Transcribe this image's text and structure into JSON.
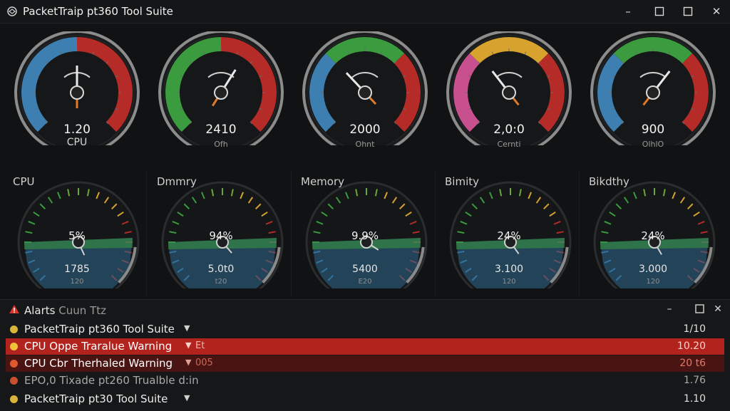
{
  "window": {
    "title": "PacketTraip pt360 Tool Suite",
    "controls": [
      "–",
      "☐",
      "✕"
    ]
  },
  "top_gauges": [
    {
      "value": "1.20",
      "label": "CPU",
      "needle_fraction": 0.5,
      "colors": [
        "#3d7fb0",
        "#b52b28"
      ]
    },
    {
      "value": "2410",
      "label": "Ofh",
      "needle_fraction": 0.62,
      "colors": [
        "#3a9b3f",
        "#b52b28"
      ]
    },
    {
      "value": "2000",
      "label": "Ohnt",
      "needle_fraction": 0.34,
      "colors": [
        "#3d7fb0",
        "#3a9b3f",
        "#b52b28"
      ]
    },
    {
      "value": "2,0:0",
      "label": "Cernti",
      "needle_fraction": 0.36,
      "colors": [
        "#c9508f",
        "#d8a22e",
        "#b52b28"
      ]
    },
    {
      "value": "900",
      "label": "OlhlO",
      "needle_fraction": 0.64,
      "colors": [
        "#3d7fb0",
        "#3a9b3f",
        "#b52b28"
      ]
    }
  ],
  "mid_gauges": [
    {
      "label": "CPU",
      "pct": "5%",
      "value": "1785",
      "sub": "120",
      "needle_fraction": 0.52
    },
    {
      "label": "Dmmry",
      "pct": "94%",
      "value": "5.0t0",
      "sub": "t20",
      "needle_fraction": 0.46
    },
    {
      "label": "Memory",
      "pct": "9.9%",
      "value": "5400",
      "sub": "E20",
      "needle_fraction": 0.4
    },
    {
      "label": "Bimity",
      "pct": "24%",
      "value": "3.100",
      "sub": "120",
      "needle_fraction": 0.48
    },
    {
      "label": "Bikdthy",
      "pct": "24%",
      "value": "3.000",
      "sub": "120",
      "needle_fraction": 0.5
    }
  ],
  "alerts": {
    "title": "Alarts",
    "title_dim": "Cuun Ttz",
    "rows": [
      {
        "text": "PacketTraip pt360 Tool Suite",
        "extra": "",
        "time": "1/10",
        "dot": "#d7b53a",
        "style": "normal"
      },
      {
        "text": "CPU Oppe Traralue Warning",
        "extra": "Et",
        "time": "10.20",
        "dot": "#f0c23a",
        "style": "red"
      },
      {
        "text": "CPU Cbr Therhaled Warning",
        "extra": "005",
        "time": "20 t6",
        "dot": "#e05a2d",
        "style": "red2"
      },
      {
        "text": "EPO,0 Tixade pt260 Trualble d:in",
        "extra": "",
        "time": "1.76",
        "dot": "#c9502e",
        "style": "dim"
      },
      {
        "text": "PacketTraip pt30 Tool Suite",
        "extra": "",
        "time": "1.10",
        "dot": "#d7b53a",
        "style": "normal"
      }
    ]
  }
}
